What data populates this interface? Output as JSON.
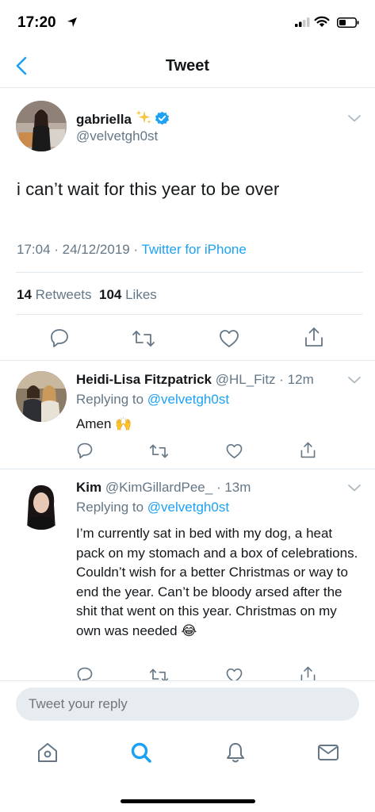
{
  "status_bar": {
    "time": "17:20"
  },
  "nav": {
    "title": "Tweet"
  },
  "tweet": {
    "author_name": "gabriella",
    "author_handle": "@velvetgh0st",
    "text": "i can’t wait for this year to be over",
    "timestamp": "17:04 · 24/12/2019 ·",
    "source": "Twitter for iPhone",
    "retweets_count": "14",
    "retweets_label": "Retweets",
    "likes_count": "104",
    "likes_label": "Likes"
  },
  "replies": [
    {
      "name": "Heidi-Lisa Fitzpatrick",
      "handle_time": "@HL_Fitz · 12m",
      "replying_prefix": "Replying to",
      "replying_to": "@velvetgh0st",
      "text": "Amen 🙌"
    },
    {
      "name": "Kim",
      "handle_time": "@KimGillardPee_ · 13m",
      "replying_prefix": "Replying to",
      "replying_to": "@velvetgh0st",
      "text": "I’m currently sat in bed with my dog, a heat pack on my stomach and a box of celebrations. Couldn’t wish for a better Christmas or way to end the year. Can’t be bloody arsed after the shit that went on this year. Christmas on my own was needed 😂"
    }
  ],
  "reply_box": {
    "placeholder": "Tweet your reply"
  },
  "icons": {
    "back": "chevron-left-icon",
    "tabs": [
      "home-icon",
      "search-icon",
      "bell-icon",
      "mail-icon"
    ]
  },
  "colors": {
    "accent": "#1da1f2",
    "secondary_text": "#657786",
    "divider": "#e1e8ed"
  }
}
